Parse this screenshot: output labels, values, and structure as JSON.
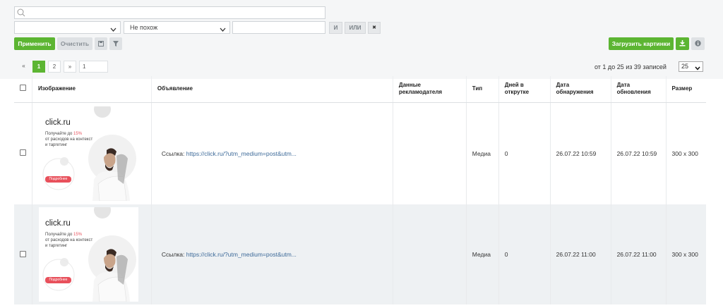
{
  "filters": {
    "search_value": "",
    "select1_value": "",
    "select2_value": "Не похож",
    "text_value": "",
    "and_label": "И",
    "or_label": "ИЛИ",
    "clear_x_label": "✖",
    "apply_label": "Применить",
    "clear_label": "Очистить",
    "load_images_label": "Загрузить картинки"
  },
  "pagination": {
    "prev": "«",
    "pages": [
      "1",
      "2"
    ],
    "next": "»",
    "goto_value": "1",
    "records_text": "от 1 до 25 из 39 записей",
    "per_page": "25"
  },
  "table": {
    "headers": {
      "image": "Изображение",
      "ad": "Объявление",
      "advertiser": "Данные рекламодателя",
      "type": "Тип",
      "days": "Дней в открутке",
      "found": "Дата обнаружения",
      "updated": "Дата обновления",
      "size": "Размер"
    },
    "rows": [
      {
        "link_prefix": "Ссылка:",
        "link": "https://click.ru/?utm_medium=post&utm...",
        "advertiser": "",
        "type": "Медиа",
        "days": "0",
        "found": "26.07.22 10:59",
        "updated": "26.07.22 10:59",
        "size": "300 x 300",
        "banner": {
          "brand": "click.ru",
          "line1_pre": "Получайте до ",
          "line1_hl": "15%",
          "line2": "от расходов на контекст",
          "line3": "и таргетинг",
          "cta": "Подробнее"
        }
      },
      {
        "link_prefix": "Ссылка:",
        "link": "https://click.ru/?utm_medium=post&utm...",
        "advertiser": "",
        "type": "Медиа",
        "days": "0",
        "found": "26.07.22 11:00",
        "updated": "26.07.22 11:00",
        "size": "300 x 300",
        "banner": {
          "brand": "click.ru",
          "line1_pre": "Получайте до ",
          "line1_hl": "15%",
          "line2": "от расходов на контекст",
          "line3": "и таргетинг",
          "cta": "Подробнее"
        }
      }
    ]
  },
  "colors": {
    "accent": "#5cb532",
    "link": "#3d6a99",
    "banner_cta": "#e8505b"
  }
}
